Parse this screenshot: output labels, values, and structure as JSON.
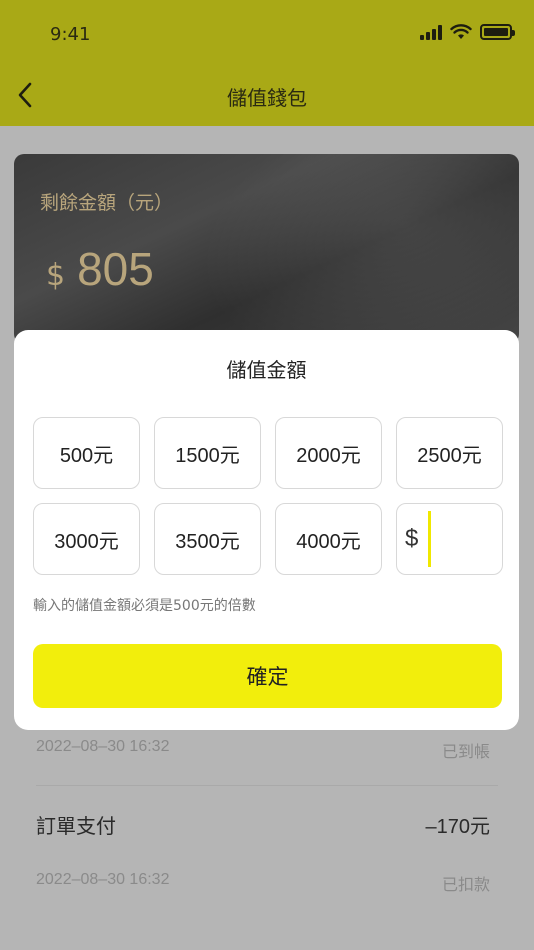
{
  "status_bar": {
    "time": "9:41"
  },
  "header": {
    "title": "儲值錢包"
  },
  "wallet": {
    "label": "剩餘金額（元）",
    "currency_symbol": "$",
    "balance": "805"
  },
  "modal": {
    "title": "儲值金額",
    "options": [
      "500元",
      "1500元",
      "2000元",
      "2500元",
      "3000元",
      "3500元",
      "4000元"
    ],
    "custom_currency": "$",
    "custom_value": "",
    "hint": "輸入的儲值金額必須是500元的倍數",
    "confirm_label": "確定"
  },
  "transactions": [
    {
      "date": "2022–08–30 16:32",
      "status": "已到帳"
    },
    {
      "title": "訂單支付",
      "amount": "–170元",
      "date": "2022–08–30 16:32",
      "status": "已扣款"
    }
  ],
  "colors": {
    "header_bg": "#a9a916",
    "accent_yellow": "#f2ee0c",
    "balance_gold": "#b8a57c",
    "overlay_gray": "#b5b5b5"
  }
}
